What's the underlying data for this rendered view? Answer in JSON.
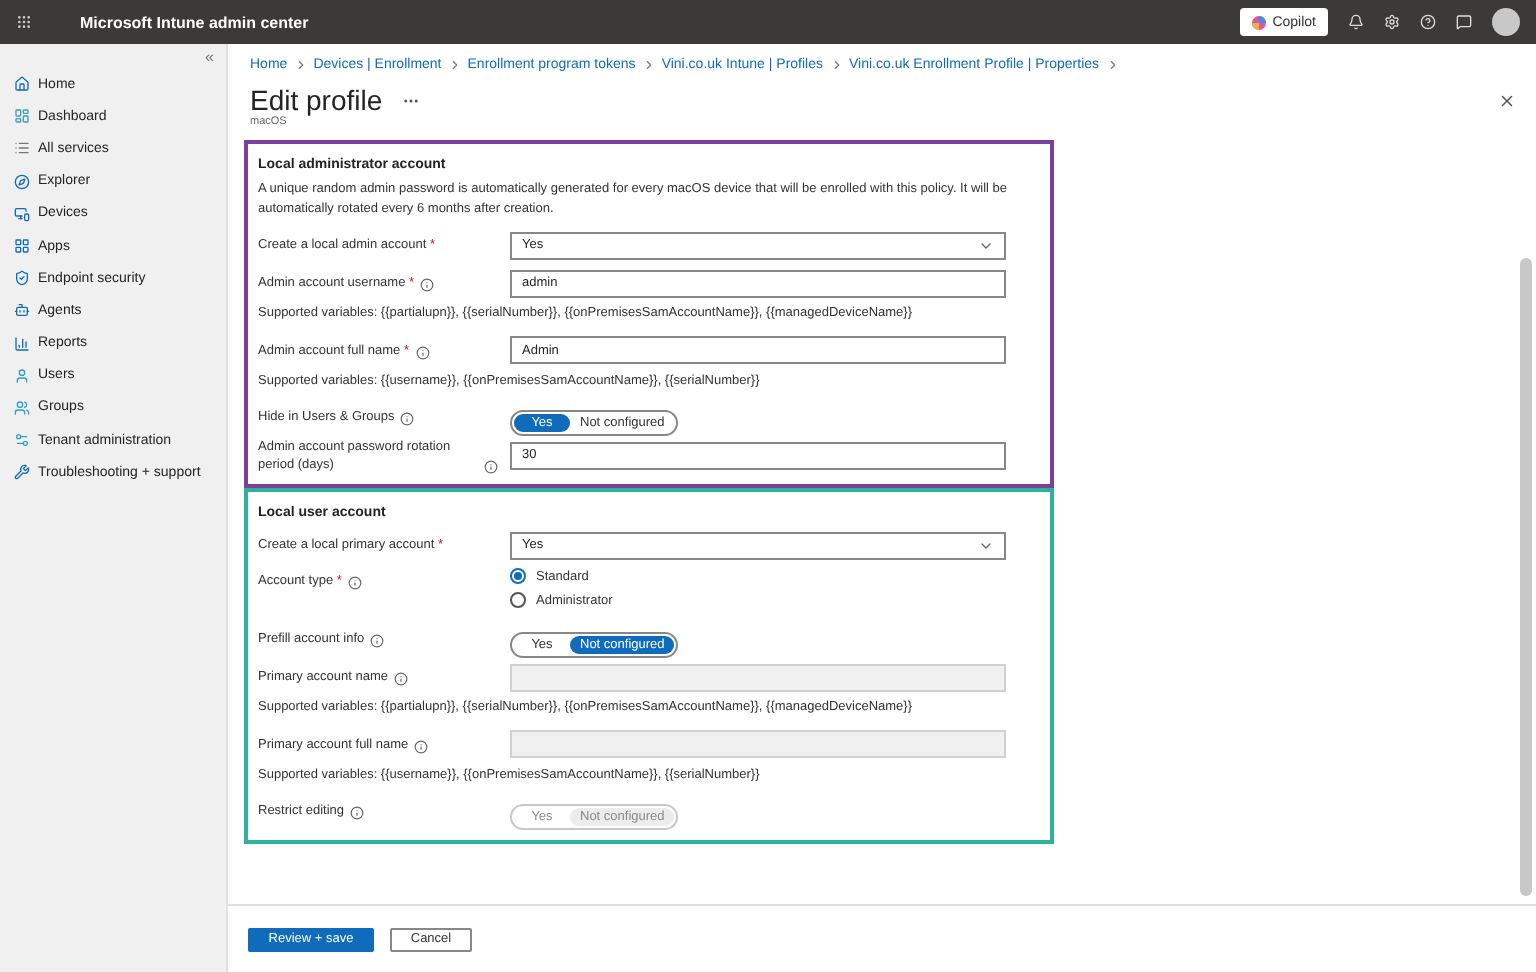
{
  "app_bar": {
    "title": "Microsoft Intune admin center",
    "copilot": "Copilot"
  },
  "sidebar": {
    "collapse": "«",
    "items": [
      {
        "label": "Home",
        "selected": false
      },
      {
        "label": "Dashboard",
        "selected": false
      },
      {
        "label": "All services",
        "selected": false
      },
      {
        "label": "Explorer",
        "selected": false
      },
      {
        "label": "Devices",
        "selected": false
      },
      {
        "label": "Apps",
        "selected": false
      },
      {
        "label": "Endpoint security",
        "selected": false
      },
      {
        "label": "Agents",
        "selected": false
      },
      {
        "label": "Reports",
        "selected": false
      },
      {
        "label": "Users",
        "selected": false
      },
      {
        "label": "Groups",
        "selected": false
      },
      {
        "label": "Tenant administration",
        "selected": false
      },
      {
        "label": "Troubleshooting + support",
        "selected": false
      }
    ]
  },
  "breadcrumb": [
    "Home",
    "Devices | Enrollment",
    "Enrollment program tokens",
    "Vini.co.uk Intune | Profiles",
    "Vini.co.uk Enrollment Profile | Properties"
  ],
  "page": {
    "title": "Edit profile",
    "subtitle": "macOS"
  },
  "sections": [
    {
      "title": "Local administrator account",
      "color": "#7b3f9e",
      "fields": [
        {
          "kind": "note",
          "text": "A unique random admin password is automatically generated for every macOS device that will be enrolled with this policy. It will be automatically rotated every 6 months after creation."
        },
        {
          "kind": "select",
          "label": "Create a local admin account",
          "required_mark": "*",
          "info": false,
          "value": "Yes"
        },
        {
          "kind": "text",
          "label": "Admin account username",
          "required_mark": "*",
          "info": true,
          "value": "admin",
          "disabled": false
        },
        {
          "kind": "note",
          "text": "Supported variables: {{partialupn}}, {{serialNumber}}, {{onPremisesSamAccountName}}, {{managedDeviceName}}"
        },
        {
          "kind": "text",
          "label": "Admin account full name",
          "required_mark": "*",
          "info": true,
          "value": "Admin",
          "disabled": false
        },
        {
          "kind": "note",
          "text": "Supported variables: {{username}}, {{onPremisesSamAccountName}}, {{serialNumber}}"
        },
        {
          "kind": "toggle",
          "label": "Hide in Users & Groups",
          "info": true,
          "disabled": false,
          "options": [
            {
              "label": "Yes",
              "selected": true
            },
            {
              "label": "Not configured",
              "selected": false
            }
          ]
        },
        {
          "kind": "text",
          "label": "Admin account password rotation period (days)",
          "info": true,
          "value": "30",
          "disabled": false
        }
      ]
    },
    {
      "title": "Local user account",
      "color": "#2eb398",
      "fields": [
        {
          "kind": "select",
          "label": "Create a local primary account",
          "required_mark": "*",
          "info": false,
          "value": "Yes"
        },
        {
          "kind": "radio",
          "label": "Account type",
          "required_mark": "*",
          "info": true,
          "options": [
            {
              "label": "Standard",
              "selected": true
            },
            {
              "label": "Administrator",
              "selected": false
            }
          ]
        },
        {
          "kind": "toggle",
          "label": "Prefill account info",
          "info": true,
          "disabled": false,
          "options": [
            {
              "label": "Yes",
              "selected": false
            },
            {
              "label": "Not configured",
              "selected": true
            }
          ]
        },
        {
          "kind": "text",
          "label": "Primary account name",
          "info": true,
          "disabled": true
        },
        {
          "kind": "note",
          "text": "Supported variables: {{partialupn}}, {{serialNumber}}, {{onPremisesSamAccountName}}, {{managedDeviceName}}"
        },
        {
          "kind": "text",
          "label": "Primary account full name",
          "info": true,
          "disabled": true
        },
        {
          "kind": "note",
          "text": "Supported variables: {{username}}, {{onPremisesSamAccountName}}, {{serialNumber}}"
        },
        {
          "kind": "toggle",
          "label": "Restrict editing",
          "info": true,
          "disabled": true,
          "options": [
            {
              "label": "Yes",
              "selected": false
            },
            {
              "label": "Not configured",
              "selected": true
            }
          ]
        }
      ]
    }
  ],
  "footer": {
    "primary": "Review + save",
    "secondary": "Cancel"
  }
}
